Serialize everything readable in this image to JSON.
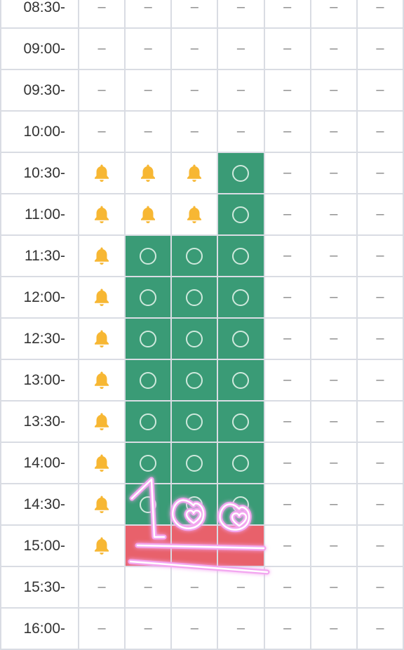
{
  "schedule": {
    "slots": [
      {
        "time": "08:30-",
        "cells": [
          "dash",
          "dash",
          "dash",
          "dash",
          "dash",
          "dash",
          "dash"
        ]
      },
      {
        "time": "09:00-",
        "cells": [
          "dash",
          "dash",
          "dash",
          "dash",
          "dash",
          "dash",
          "dash"
        ]
      },
      {
        "time": "09:30-",
        "cells": [
          "dash",
          "dash",
          "dash",
          "dash",
          "dash",
          "dash",
          "dash"
        ]
      },
      {
        "time": "10:00-",
        "cells": [
          "dash",
          "dash",
          "dash",
          "dash",
          "dash",
          "dash",
          "dash"
        ]
      },
      {
        "time": "10:30-",
        "cells": [
          "bell",
          "bell",
          "bell",
          "open",
          "dash",
          "dash",
          "dash"
        ]
      },
      {
        "time": "11:00-",
        "cells": [
          "bell",
          "bell",
          "bell",
          "open",
          "dash",
          "dash",
          "dash"
        ]
      },
      {
        "time": "11:30-",
        "cells": [
          "bell",
          "open",
          "open",
          "open",
          "dash",
          "dash",
          "dash"
        ]
      },
      {
        "time": "12:00-",
        "cells": [
          "bell",
          "open",
          "open",
          "open",
          "dash",
          "dash",
          "dash"
        ]
      },
      {
        "time": "12:30-",
        "cells": [
          "bell",
          "open",
          "open",
          "open",
          "dash",
          "dash",
          "dash"
        ]
      },
      {
        "time": "13:00-",
        "cells": [
          "bell",
          "open",
          "open",
          "open",
          "dash",
          "dash",
          "dash"
        ]
      },
      {
        "time": "13:30-",
        "cells": [
          "bell",
          "open",
          "open",
          "open",
          "dash",
          "dash",
          "dash"
        ]
      },
      {
        "time": "14:00-",
        "cells": [
          "bell",
          "open",
          "open",
          "open",
          "dash",
          "dash",
          "dash"
        ]
      },
      {
        "time": "14:30-",
        "cells": [
          "bell",
          "open",
          "open",
          "open",
          "dash",
          "dash",
          "dash"
        ]
      },
      {
        "time": "15:00-",
        "cells": [
          "bell",
          "full",
          "full",
          "full",
          "dash",
          "dash",
          "dash"
        ]
      },
      {
        "time": "15:30-",
        "cells": [
          "dash",
          "dash",
          "dash",
          "dash",
          "dash",
          "dash",
          "dash"
        ]
      },
      {
        "time": "16:00-",
        "cells": [
          "dash",
          "dash",
          "dash",
          "dash",
          "dash",
          "dash",
          "dash"
        ]
      }
    ],
    "dash_symbol": "–",
    "colors": {
      "open": "#3a9b76",
      "full": "#e8616b",
      "bell": "#f7b733",
      "grid_line": "#d9dce3"
    },
    "icons": {
      "bell": "bell-icon",
      "open": "circle-icon",
      "sticker": "hundred-points-icon"
    }
  }
}
